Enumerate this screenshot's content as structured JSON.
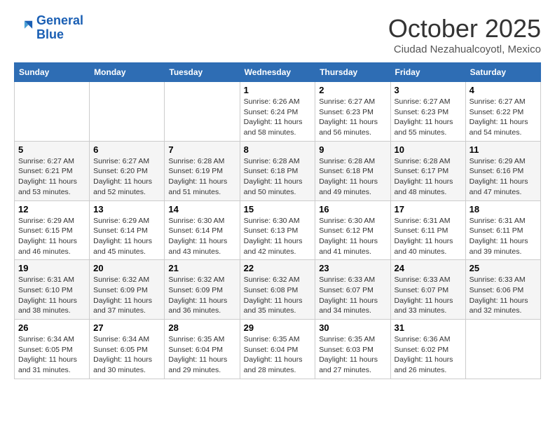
{
  "header": {
    "logo_line1": "General",
    "logo_line2": "Blue",
    "month_title": "October 2025",
    "subtitle": "Ciudad Nezahualcoyotl, Mexico"
  },
  "days_of_week": [
    "Sunday",
    "Monday",
    "Tuesday",
    "Wednesday",
    "Thursday",
    "Friday",
    "Saturday"
  ],
  "weeks": [
    [
      {
        "num": "",
        "info": ""
      },
      {
        "num": "",
        "info": ""
      },
      {
        "num": "",
        "info": ""
      },
      {
        "num": "1",
        "info": "Sunrise: 6:26 AM\nSunset: 6:24 PM\nDaylight: 11 hours\nand 58 minutes."
      },
      {
        "num": "2",
        "info": "Sunrise: 6:27 AM\nSunset: 6:23 PM\nDaylight: 11 hours\nand 56 minutes."
      },
      {
        "num": "3",
        "info": "Sunrise: 6:27 AM\nSunset: 6:23 PM\nDaylight: 11 hours\nand 55 minutes."
      },
      {
        "num": "4",
        "info": "Sunrise: 6:27 AM\nSunset: 6:22 PM\nDaylight: 11 hours\nand 54 minutes."
      }
    ],
    [
      {
        "num": "5",
        "info": "Sunrise: 6:27 AM\nSunset: 6:21 PM\nDaylight: 11 hours\nand 53 minutes."
      },
      {
        "num": "6",
        "info": "Sunrise: 6:27 AM\nSunset: 6:20 PM\nDaylight: 11 hours\nand 52 minutes."
      },
      {
        "num": "7",
        "info": "Sunrise: 6:28 AM\nSunset: 6:19 PM\nDaylight: 11 hours\nand 51 minutes."
      },
      {
        "num": "8",
        "info": "Sunrise: 6:28 AM\nSunset: 6:18 PM\nDaylight: 11 hours\nand 50 minutes."
      },
      {
        "num": "9",
        "info": "Sunrise: 6:28 AM\nSunset: 6:18 PM\nDaylight: 11 hours\nand 49 minutes."
      },
      {
        "num": "10",
        "info": "Sunrise: 6:28 AM\nSunset: 6:17 PM\nDaylight: 11 hours\nand 48 minutes."
      },
      {
        "num": "11",
        "info": "Sunrise: 6:29 AM\nSunset: 6:16 PM\nDaylight: 11 hours\nand 47 minutes."
      }
    ],
    [
      {
        "num": "12",
        "info": "Sunrise: 6:29 AM\nSunset: 6:15 PM\nDaylight: 11 hours\nand 46 minutes."
      },
      {
        "num": "13",
        "info": "Sunrise: 6:29 AM\nSunset: 6:14 PM\nDaylight: 11 hours\nand 45 minutes."
      },
      {
        "num": "14",
        "info": "Sunrise: 6:30 AM\nSunset: 6:14 PM\nDaylight: 11 hours\nand 43 minutes."
      },
      {
        "num": "15",
        "info": "Sunrise: 6:30 AM\nSunset: 6:13 PM\nDaylight: 11 hours\nand 42 minutes."
      },
      {
        "num": "16",
        "info": "Sunrise: 6:30 AM\nSunset: 6:12 PM\nDaylight: 11 hours\nand 41 minutes."
      },
      {
        "num": "17",
        "info": "Sunrise: 6:31 AM\nSunset: 6:11 PM\nDaylight: 11 hours\nand 40 minutes."
      },
      {
        "num": "18",
        "info": "Sunrise: 6:31 AM\nSunset: 6:11 PM\nDaylight: 11 hours\nand 39 minutes."
      }
    ],
    [
      {
        "num": "19",
        "info": "Sunrise: 6:31 AM\nSunset: 6:10 PM\nDaylight: 11 hours\nand 38 minutes."
      },
      {
        "num": "20",
        "info": "Sunrise: 6:32 AM\nSunset: 6:09 PM\nDaylight: 11 hours\nand 37 minutes."
      },
      {
        "num": "21",
        "info": "Sunrise: 6:32 AM\nSunset: 6:09 PM\nDaylight: 11 hours\nand 36 minutes."
      },
      {
        "num": "22",
        "info": "Sunrise: 6:32 AM\nSunset: 6:08 PM\nDaylight: 11 hours\nand 35 minutes."
      },
      {
        "num": "23",
        "info": "Sunrise: 6:33 AM\nSunset: 6:07 PM\nDaylight: 11 hours\nand 34 minutes."
      },
      {
        "num": "24",
        "info": "Sunrise: 6:33 AM\nSunset: 6:07 PM\nDaylight: 11 hours\nand 33 minutes."
      },
      {
        "num": "25",
        "info": "Sunrise: 6:33 AM\nSunset: 6:06 PM\nDaylight: 11 hours\nand 32 minutes."
      }
    ],
    [
      {
        "num": "26",
        "info": "Sunrise: 6:34 AM\nSunset: 6:05 PM\nDaylight: 11 hours\nand 31 minutes."
      },
      {
        "num": "27",
        "info": "Sunrise: 6:34 AM\nSunset: 6:05 PM\nDaylight: 11 hours\nand 30 minutes."
      },
      {
        "num": "28",
        "info": "Sunrise: 6:35 AM\nSunset: 6:04 PM\nDaylight: 11 hours\nand 29 minutes."
      },
      {
        "num": "29",
        "info": "Sunrise: 6:35 AM\nSunset: 6:04 PM\nDaylight: 11 hours\nand 28 minutes."
      },
      {
        "num": "30",
        "info": "Sunrise: 6:35 AM\nSunset: 6:03 PM\nDaylight: 11 hours\nand 27 minutes."
      },
      {
        "num": "31",
        "info": "Sunrise: 6:36 AM\nSunset: 6:02 PM\nDaylight: 11 hours\nand 26 minutes."
      },
      {
        "num": "",
        "info": ""
      }
    ]
  ]
}
